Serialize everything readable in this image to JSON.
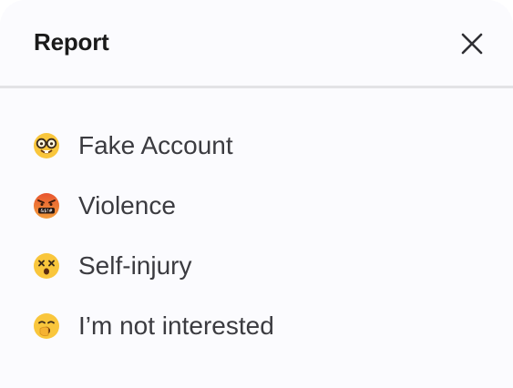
{
  "dialog": {
    "title": "Report",
    "close_icon": "close-icon"
  },
  "options": [
    {
      "label": "Fake Account",
      "icon": "nerd-face-icon"
    },
    {
      "label": "Violence",
      "icon": "cursing-face-icon"
    },
    {
      "label": "Self-injury",
      "icon": "dizzy-face-icon"
    },
    {
      "label": "I’m not interested",
      "icon": "yawning-face-icon"
    }
  ],
  "colors": {
    "background": "#fbfbfe",
    "divider": "#e3e3e6",
    "title": "#1a1a1a",
    "text": "#3b3b40",
    "emoji_yellow": "#f9c63c",
    "emoji_red": "#e8552f"
  }
}
